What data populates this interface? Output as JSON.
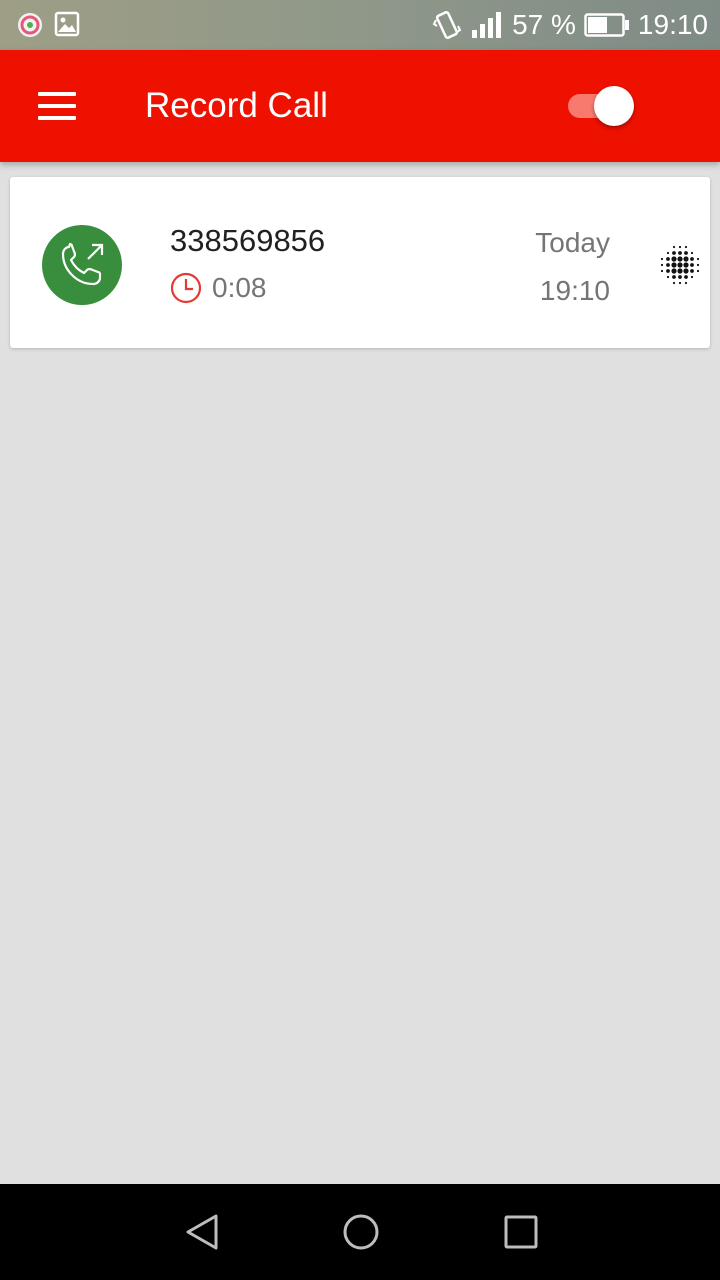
{
  "status_bar": {
    "battery_percent": "57 %",
    "battery_level": 0.57,
    "time": "19:10",
    "icons": [
      "app-notification-icon",
      "image-notification-icon",
      "vibrate-icon",
      "signal-icon",
      "battery-icon"
    ]
  },
  "app_bar": {
    "title": "Record Call",
    "menu_icon": "menu-icon",
    "recording_toggle": {
      "state": "on"
    }
  },
  "calls": [
    {
      "type": "outgoing",
      "icon": "outgoing-call-icon",
      "number": "338569856",
      "duration": "0:08",
      "date": "Today",
      "time": "19:10"
    }
  ],
  "colors": {
    "app_bar": "#ee1100",
    "call_icon_bg": "#388e3c",
    "clock_icon": "#e53935",
    "toggle_track": "#f87a6f",
    "background": "#e0e0e0"
  },
  "nav_bar": {
    "icons": [
      "back-icon",
      "home-icon",
      "recents-icon"
    ]
  }
}
